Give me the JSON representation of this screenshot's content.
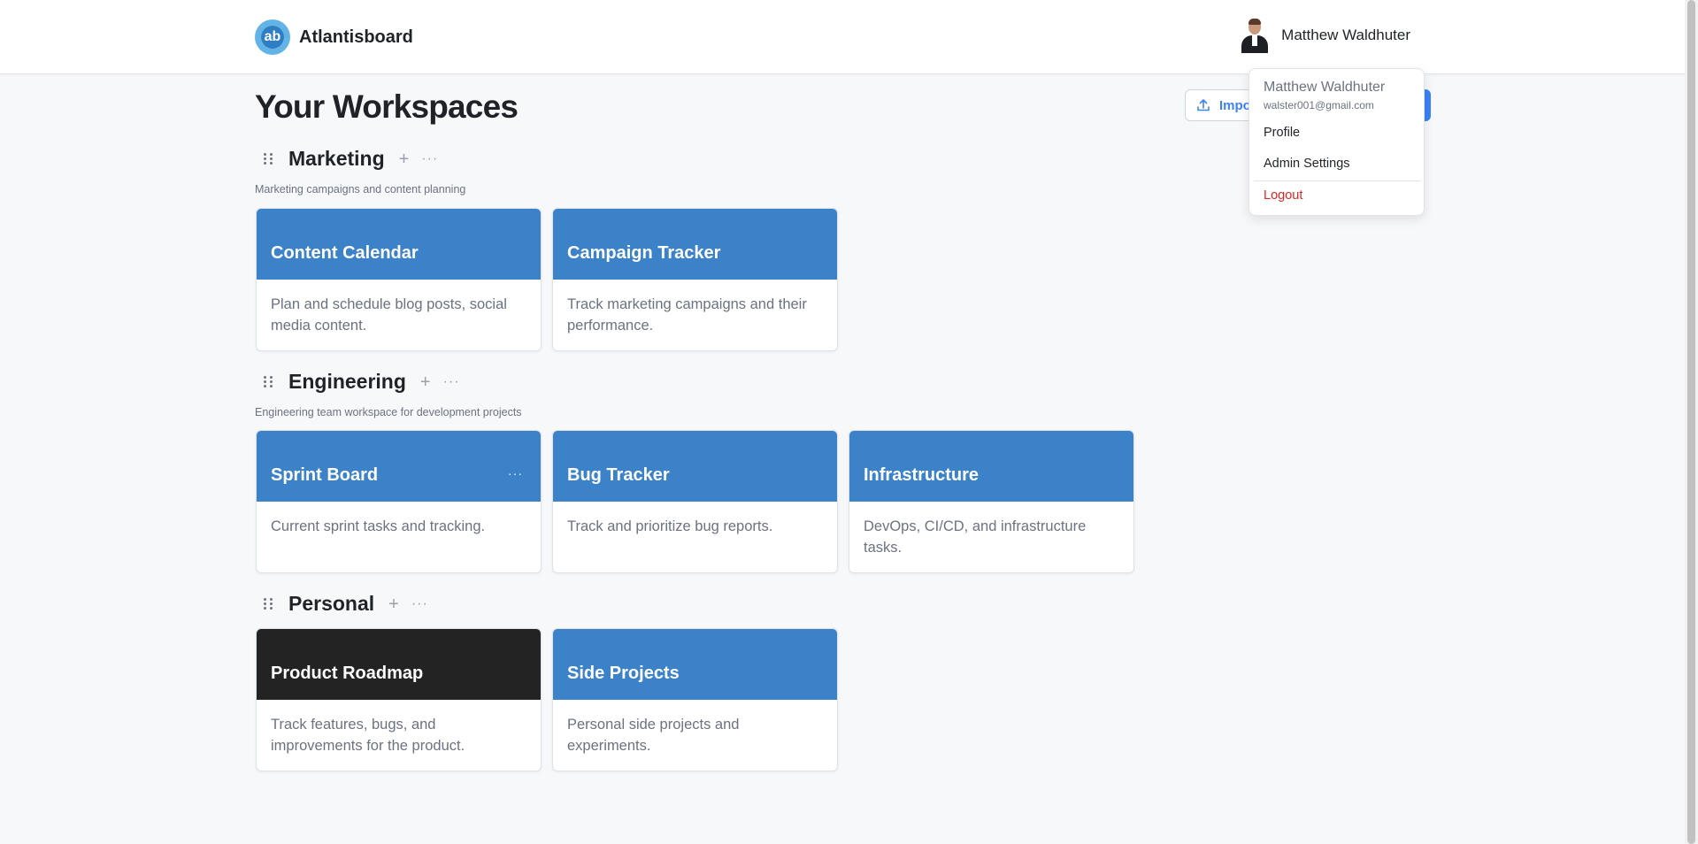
{
  "app": {
    "logo_text": "ab",
    "name": "Atlantisboard"
  },
  "user": {
    "name": "Matthew Waldhuter",
    "email": "walster001@gmail.com"
  },
  "page": {
    "title": "Your Workspaces",
    "import_label": "Impo"
  },
  "dropdown": {
    "name": "Matthew Waldhuter",
    "email": "walster001@gmail.com",
    "items": [
      "Profile",
      "Admin Settings"
    ],
    "logout": "Logout"
  },
  "workspaces": [
    {
      "name": "Marketing",
      "description": "Marketing campaigns and content planning",
      "boards": [
        {
          "title": "Content Calendar",
          "description": "Plan and schedule blog posts, social media content.",
          "color": "#3b82c9"
        },
        {
          "title": "Campaign Tracker",
          "description": "Track marketing campaigns and their performance.",
          "color": "#3b82c9"
        }
      ]
    },
    {
      "name": "Engineering",
      "description": "Engineering team workspace for development projects",
      "boards": [
        {
          "title": "Sprint Board",
          "description": "Current sprint tasks and tracking.",
          "color": "#3b82c9",
          "menu": "···"
        },
        {
          "title": "Bug Tracker",
          "description": "Track and prioritize bug reports.",
          "color": "#3b82c9"
        },
        {
          "title": "Infrastructure",
          "description": "DevOps, CI/CD, and infrastructure tasks.",
          "color": "#3b82c9"
        }
      ]
    },
    {
      "name": "Personal",
      "boards": [
        {
          "title": "Product Roadmap",
          "description": "Track features, bugs, and improvements for the product.",
          "color": "#232323"
        },
        {
          "title": "Side Projects",
          "description": "Personal side projects and experiments.",
          "color": "#3b82c9"
        }
      ]
    }
  ],
  "icons": {
    "add": "+",
    "more": "···"
  }
}
